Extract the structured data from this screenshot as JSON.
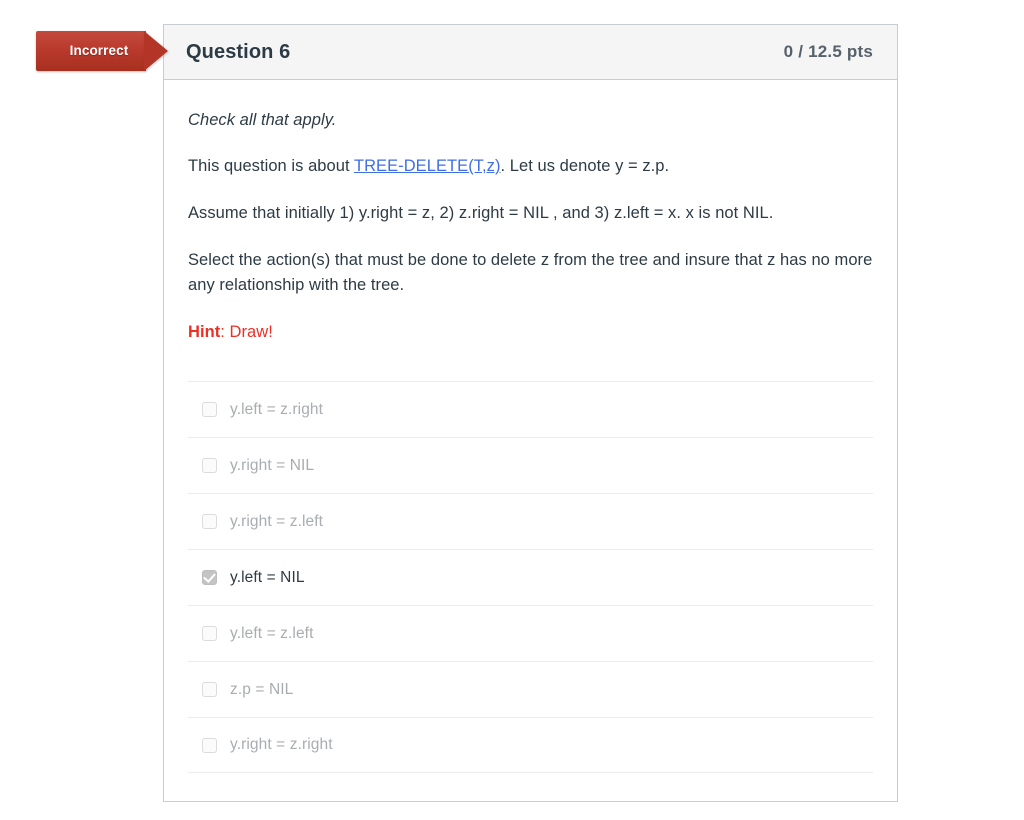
{
  "status_badge": {
    "label": "Incorrect",
    "color": "#b8392c"
  },
  "question": {
    "title": "Question 6",
    "points": "0 / 12.5 pts",
    "prompt_italic": "Check all that apply.",
    "line2_before": "This question is about ",
    "line2_link": "TREE-DELETE(T,z)",
    "line2_after": ". Let us denote y = z.p.",
    "line3": "Assume that initially 1) y.right = z, 2) z.right = NIL , and 3) z.left = x.  x is not NIL.",
    "line4": "Select the action(s) that must be done to delete z from the tree and insure that z has no more any relationship with the tree.",
    "hint_word": "Hint",
    "hint_rest": ": Draw!",
    "link_color": "#3e6ee8",
    "hint_color": "#ee2f24"
  },
  "answers": [
    {
      "label": "y.left = z.right",
      "checked": false
    },
    {
      "label": "y.right = NIL",
      "checked": false
    },
    {
      "label": "y.right = z.left",
      "checked": false
    },
    {
      "label": "y.left = NIL",
      "checked": true
    },
    {
      "label": "y.left = z.left",
      "checked": false
    },
    {
      "label": "z.p = NIL",
      "checked": false
    },
    {
      "label": "y.right = z.right",
      "checked": false
    }
  ]
}
